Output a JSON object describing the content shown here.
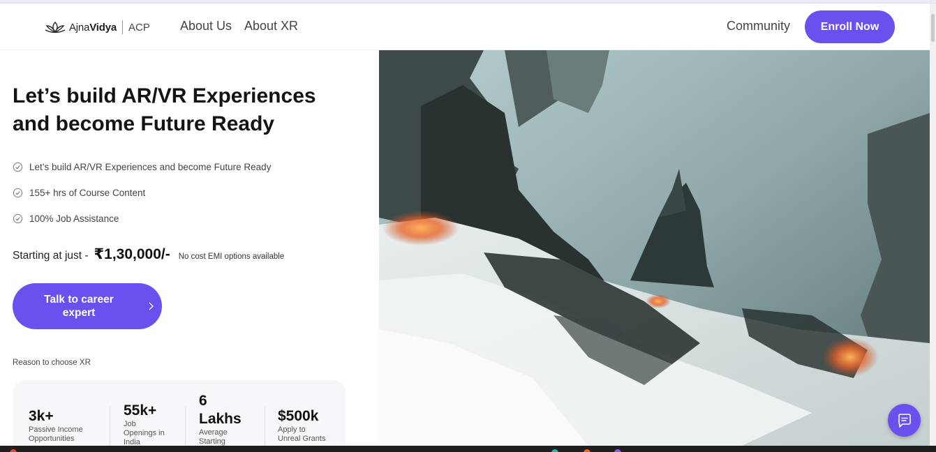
{
  "header": {
    "brand_light": "Ajna",
    "brand_bold": "Vidya",
    "brand_suffix": "ACP",
    "nav": {
      "about_us": "About Us",
      "about_xr": "About XR",
      "community": "Community"
    },
    "enroll_label": "Enroll Now"
  },
  "hero": {
    "title_line1": "Let’s build AR/VR Experiences",
    "title_line2": "and become Future Ready",
    "features": [
      "Let’s build AR/VR Experiences and become Future Ready",
      "155+ hrs of Course Content",
      "100% Job Assistance"
    ],
    "price_prefix": "Starting at just -",
    "price_value": "₹1,30,000/-",
    "price_note": "No cost EMI options available",
    "cta_line1": "Talk to career",
    "cta_line2": "expert"
  },
  "reasons": {
    "label": "Reason to choose XR",
    "stats": [
      {
        "value": "3k+",
        "desc_lines": [
          "Passive Income",
          "Opportunities"
        ]
      },
      {
        "value": "55k+",
        "desc_lines": [
          "Job",
          "Openings in",
          "India"
        ]
      },
      {
        "value_lines": [
          "6",
          "Lakhs"
        ],
        "desc_lines": [
          "Average",
          "Starting"
        ]
      },
      {
        "value": "$500k",
        "desc_lines": [
          "Apply to",
          "Unreal Grants"
        ]
      }
    ]
  },
  "colors": {
    "accent": "#6a50ee",
    "text_dark": "#141414",
    "card_bg": "#f7f6fb"
  },
  "icons": {
    "logo": "lotus-icon",
    "feature": "check-circle-icon",
    "cta": "chevron-right-icon",
    "chat": "chat-icon"
  }
}
